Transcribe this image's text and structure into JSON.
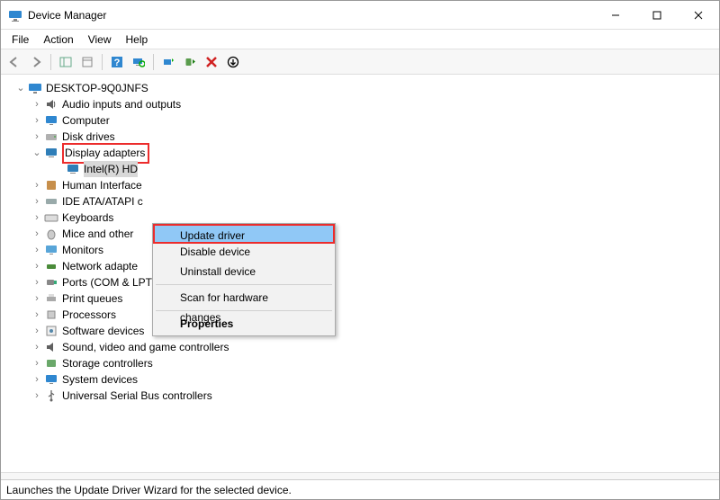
{
  "title": "Device Manager",
  "menus": {
    "file": "File",
    "action": "Action",
    "view": "View",
    "help": "Help"
  },
  "root_name": "DESKTOP-9Q0JNFS",
  "categories": {
    "audio": "Audio inputs and outputs",
    "computer": "Computer",
    "disk": "Disk drives",
    "display": "Display adapters",
    "display_child": "Intel(R) HD",
    "hid_trunc": "Human Interface",
    "ide_trunc": "IDE ATA/ATAPI c",
    "keyboards": "Keyboards",
    "mice_trunc": "Mice and other",
    "monitors": "Monitors",
    "net_trunc": "Network adapte",
    "ports": "Ports (COM & LPT)",
    "print": "Print queues",
    "processors": "Processors",
    "soft": "Software devices",
    "sound": "Sound, video and game controllers",
    "storage": "Storage controllers",
    "system": "System devices",
    "usb": "Universal Serial Bus controllers"
  },
  "context_menu": {
    "update": "Update driver",
    "disable": "Disable device",
    "uninstall": "Uninstall device",
    "scan": "Scan for hardware changes",
    "properties": "Properties"
  },
  "status": "Launches the Update Driver Wizard for the selected device."
}
